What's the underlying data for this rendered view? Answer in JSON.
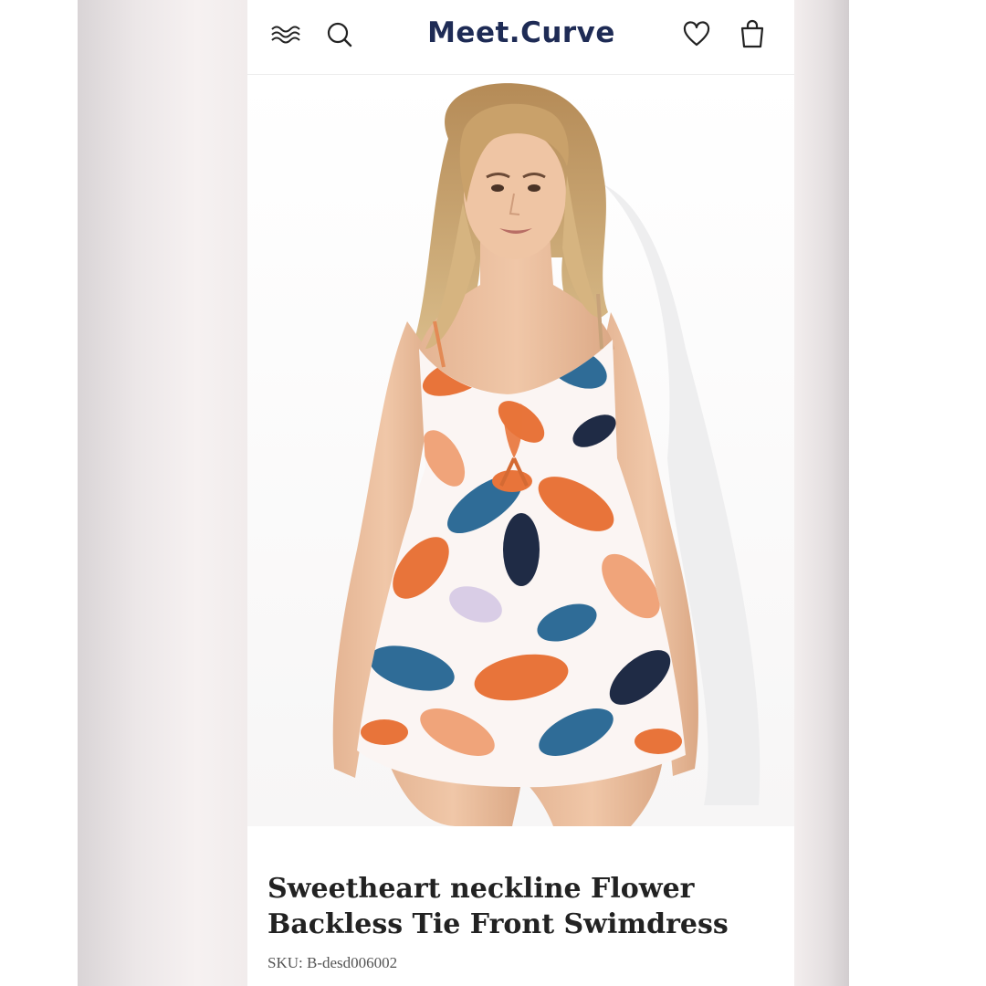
{
  "header": {
    "brand": "Meet.Curve",
    "icons": [
      "menu-icon",
      "search-icon",
      "heart-icon",
      "bag-icon"
    ]
  },
  "product": {
    "title": "Sweetheart neckline Flower Backless Tie Front Swimdress",
    "sku": "SKU: B-desd006002",
    "image_alt": "Model wearing an orange, navy and white floral swimdress"
  },
  "colors": {
    "brand": "#1e2b55",
    "print_orange": "#e8743a",
    "print_blue": "#2f6c97",
    "print_navy": "#1f2b45",
    "print_lilac": "#d9cde6"
  }
}
